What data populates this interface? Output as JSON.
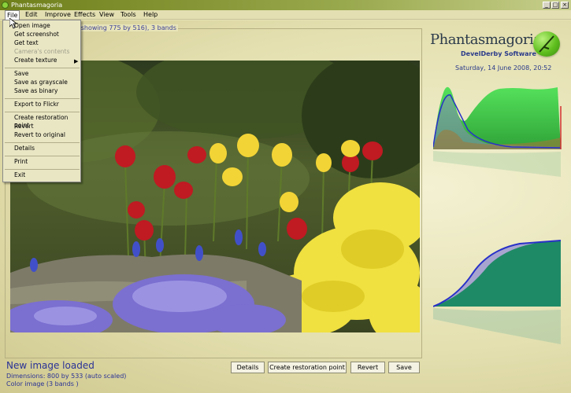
{
  "window": {
    "title": "Phantasmagoria",
    "controls": [
      "_",
      "□",
      "×"
    ]
  },
  "menubar": [
    {
      "label": "File"
    },
    {
      "label": "Edit"
    },
    {
      "label": "Improve"
    },
    {
      "label": "Effects"
    },
    {
      "label": "View"
    },
    {
      "label": "Tools"
    },
    {
      "label": "Help"
    }
  ],
  "file_menu": {
    "items": [
      {
        "label": "Open image"
      },
      {
        "label": "Get screenshot"
      },
      {
        "label": "Get text"
      },
      {
        "label": "Camera's contents",
        "disabled": true
      },
      {
        "label": "Create texture",
        "submenu": true
      },
      {
        "label": "Save"
      },
      {
        "label": "Save as grayscale"
      },
      {
        "label": "Save as binary"
      },
      {
        "label": "Export to Flickr"
      },
      {
        "label": "Create restoration point"
      },
      {
        "label": "Revert"
      },
      {
        "label": "Revert to original"
      },
      {
        "label": "Details"
      },
      {
        "label": "Print"
      },
      {
        "label": "Exit"
      }
    ]
  },
  "image_panel": {
    "frame_label": "3 (showing 775 by 516), 3 bands"
  },
  "status": {
    "title": "New image loaded",
    "line1": "Dimensions: 800 by 533 (auto scaled)",
    "line2": "Color image (3 bands )"
  },
  "buttons": {
    "details": "Details",
    "create_restoration": "Create restoration point",
    "revert": "Revert",
    "save": "Save"
  },
  "branding": {
    "logo_text": "Phantasmagoria",
    "company": "DevelDerby Software",
    "datetime": "Saturday, 14 June 2008, 20:52"
  },
  "colors": {
    "accent_blue": "#2a3296",
    "hist_green": "#33d14a",
    "hist_blue": "#2730c8",
    "hist_red": "#d23030",
    "cumul_teal": "#1f8a66"
  }
}
